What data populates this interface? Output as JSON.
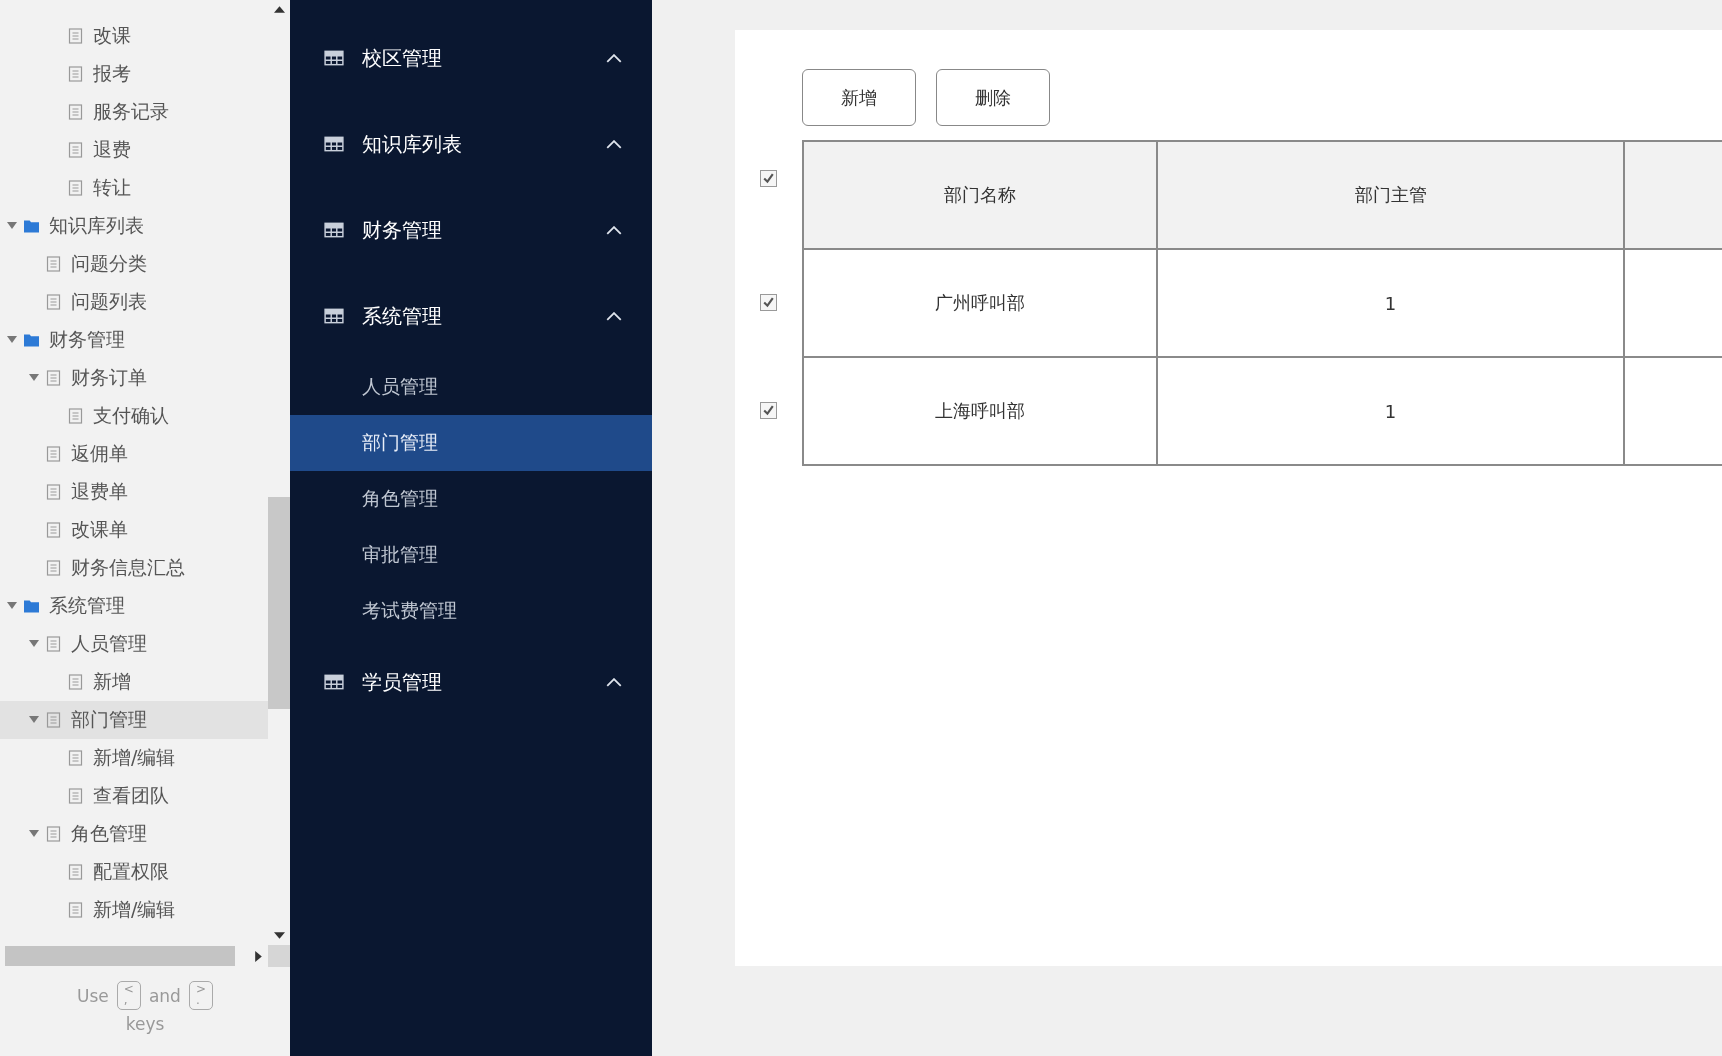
{
  "sitemap": {
    "tree": [
      {
        "children": [
          {
            "children": [
              {
                "label": "改课",
                "kind": "page",
                "selected": false
              },
              {
                "label": "报考",
                "kind": "page",
                "selected": false
              },
              {
                "label": "服务记录",
                "kind": "page",
                "selected": false
              },
              {
                "label": "退费",
                "kind": "page",
                "selected": false
              },
              {
                "label": "转让",
                "kind": "page",
                "selected": false
              }
            ]
          }
        ]
      },
      {
        "label": "知识库列表",
        "kind": "folder",
        "selected": false,
        "expanded": true,
        "children": [
          {
            "label": "问题分类",
            "kind": "page",
            "selected": false
          },
          {
            "label": "问题列表",
            "kind": "page",
            "selected": false
          }
        ]
      },
      {
        "label": "财务管理",
        "kind": "folder",
        "selected": false,
        "expanded": true,
        "children": [
          {
            "label": "财务订单",
            "kind": "page",
            "selected": false,
            "expanded": true,
            "children": [
              {
                "label": "支付确认",
                "kind": "page",
                "selected": false
              }
            ]
          },
          {
            "label": "返佣单",
            "kind": "page",
            "selected": false
          },
          {
            "label": "退费单",
            "kind": "page",
            "selected": false
          },
          {
            "label": "改课单",
            "kind": "page",
            "selected": false
          },
          {
            "label": "财务信息汇总",
            "kind": "page",
            "selected": false
          }
        ]
      },
      {
        "label": "系统管理",
        "kind": "folder",
        "selected": false,
        "expanded": true,
        "children": [
          {
            "label": "人员管理",
            "kind": "page",
            "selected": false,
            "expanded": true,
            "children": [
              {
                "label": "新增",
                "kind": "page",
                "selected": false
              }
            ]
          },
          {
            "label": "部门管理",
            "kind": "page",
            "selected": true,
            "expanded": true,
            "children": [
              {
                "label": "新增/编辑",
                "kind": "page",
                "selected": false
              },
              {
                "label": "查看团队",
                "kind": "page",
                "selected": false
              }
            ]
          },
          {
            "label": "角色管理",
            "kind": "page",
            "selected": false,
            "expanded": true,
            "children": [
              {
                "label": "配置权限",
                "kind": "page",
                "selected": false
              },
              {
                "label": "新增/编辑",
                "kind": "page",
                "selected": false
              }
            ]
          }
        ]
      }
    ],
    "hint": {
      "before": "Use",
      "key_1": {
        "top": "<",
        "bottom": ","
      },
      "middle": "and",
      "key_2": {
        "top": ">",
        "bottom": "."
      },
      "after": "keys"
    }
  },
  "nav": [
    {
      "label": "校区管理"
    },
    {
      "label": "知识库列表"
    },
    {
      "label": "财务管理"
    },
    {
      "label": "系统管理",
      "children": [
        {
          "label": "人员管理",
          "selected": false
        },
        {
          "label": "部门管理",
          "selected": true
        },
        {
          "label": "角色管理",
          "selected": false
        },
        {
          "label": "审批管理",
          "selected": false
        },
        {
          "label": "考试费管理",
          "selected": false
        }
      ]
    },
    {
      "label": "学员管理"
    }
  ],
  "toolbar": {
    "buttons": [
      "新增",
      "删除"
    ]
  },
  "table": {
    "header_checked": true,
    "columns": [
      "部门名称",
      "部门主管"
    ],
    "rows": [
      {
        "checked": true,
        "cells": [
          "广州呼叫部",
          "1"
        ]
      },
      {
        "checked": true,
        "cells": [
          "上海呼叫部",
          "1"
        ]
      }
    ]
  }
}
